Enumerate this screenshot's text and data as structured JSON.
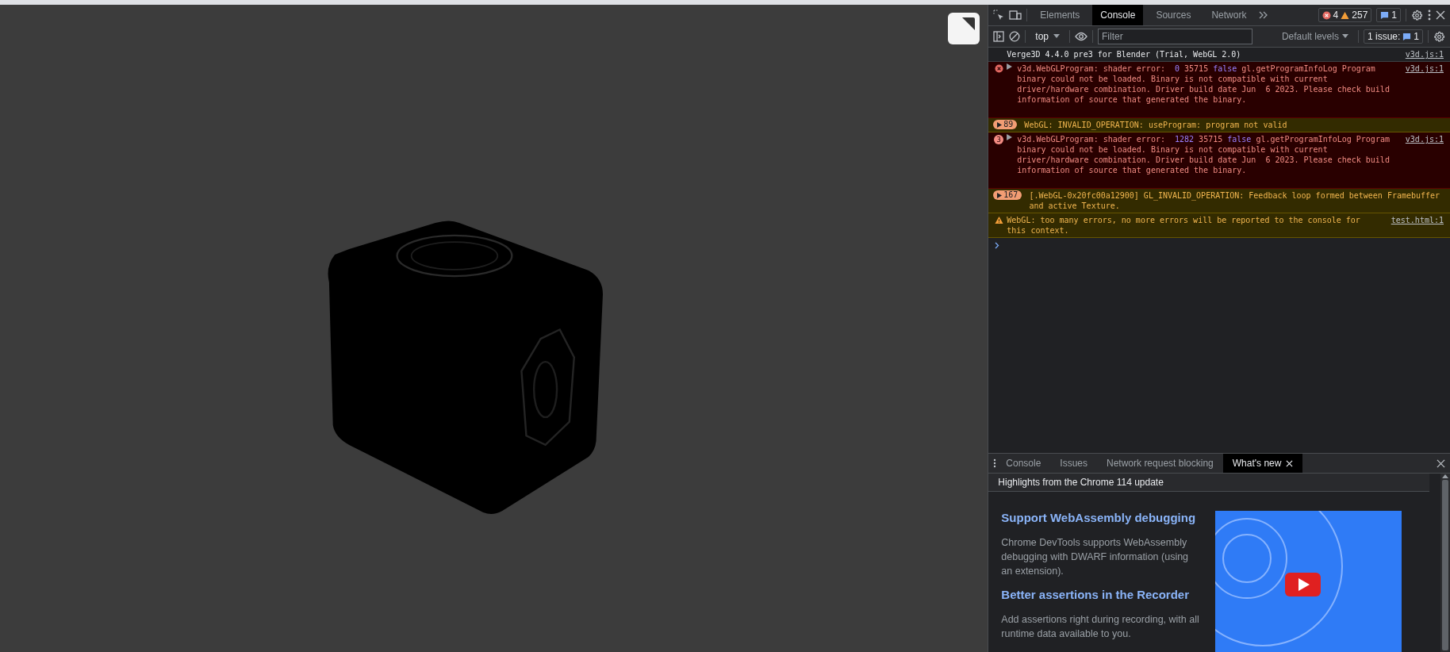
{
  "devtools": {
    "tabs": [
      {
        "label": "Elements",
        "selected": false
      },
      {
        "label": "Console",
        "selected": true
      },
      {
        "label": "Sources",
        "selected": false
      },
      {
        "label": "Network",
        "selected": false
      }
    ],
    "counters": {
      "errors": "4",
      "warnings": "257",
      "messages": "1"
    }
  },
  "console_toolbar": {
    "context": "top",
    "filter": {
      "placeholder": "Filter"
    },
    "levels": "Default levels",
    "issues_label": "1 issue:",
    "issues_count": "1"
  },
  "messages": [
    {
      "kind": "info",
      "parts": [
        {
          "kind": "plain",
          "text": "Verge3D 4.4.0 pre3 for Blender (Trial, WebGL 2.0)"
        }
      ],
      "source": "v3d.js:1"
    },
    {
      "kind": "error",
      "expandable": true,
      "parts": [
        {
          "kind": "plain",
          "text": "v3d.WebGLProgram: shader error:  "
        },
        {
          "kind": "number",
          "text": "0"
        },
        {
          "kind": "plain",
          "text": " 35715 "
        },
        {
          "kind": "keyword",
          "text": "false"
        },
        {
          "kind": "plain",
          "text": " gl.getProgramInfoLog Program binary could not be loaded. Binary is not compatible with current driver/hardware combination. Driver build date Jun  6 2023. Please check build information of source that generated the binary."
        }
      ],
      "source": "v3d.js:1"
    },
    {
      "kind": "warning",
      "count": "89",
      "parts": [
        {
          "kind": "plain",
          "text": "WebGL: INVALID_OPERATION: useProgram: program not valid"
        }
      ]
    },
    {
      "kind": "error",
      "count": "3",
      "expandable": true,
      "parts": [
        {
          "kind": "plain",
          "text": "v3d.WebGLProgram: shader error:  "
        },
        {
          "kind": "number",
          "text": "1282"
        },
        {
          "kind": "plain",
          "text": " 35715 "
        },
        {
          "kind": "keyword",
          "text": "false"
        },
        {
          "kind": "plain",
          "text": " gl.getProgramInfoLog Program binary could not be loaded. Binary is not compatible with current driver/hardware combination. Driver build date Jun  6 2023. Please check build information of source that generated the binary."
        }
      ],
      "source": "v3d.js:1"
    },
    {
      "kind": "warning",
      "count": "167",
      "parts": [
        {
          "kind": "plain",
          "text": "[.WebGL-0x20fc00a12900] GL_INVALID_OPERATION: Feedback loop formed between Framebuffer and active Texture."
        }
      ]
    },
    {
      "kind": "warning",
      "parts": [
        {
          "kind": "plain",
          "text": "WebGL: too many errors, no more errors will be reported to the console for this context."
        }
      ],
      "source": "test.html:1"
    }
  ],
  "drawer": {
    "tabs": [
      {
        "label": "Console",
        "selected": false,
        "closable": false
      },
      {
        "label": "Issues",
        "selected": false,
        "closable": false
      },
      {
        "label": "Network request blocking",
        "selected": false,
        "closable": false
      },
      {
        "label": "What's new",
        "selected": true,
        "closable": true
      }
    ],
    "header": "Highlights from the Chrome 114 update",
    "articles": [
      {
        "title": "Support WebAssembly debugging",
        "body": "Chrome DevTools supports WebAssembly debugging with DWARF information (using an extension)."
      },
      {
        "title": "Better assertions in the Recorder",
        "body": "Add assertions right during recording, with all runtime data available to you."
      }
    ]
  }
}
